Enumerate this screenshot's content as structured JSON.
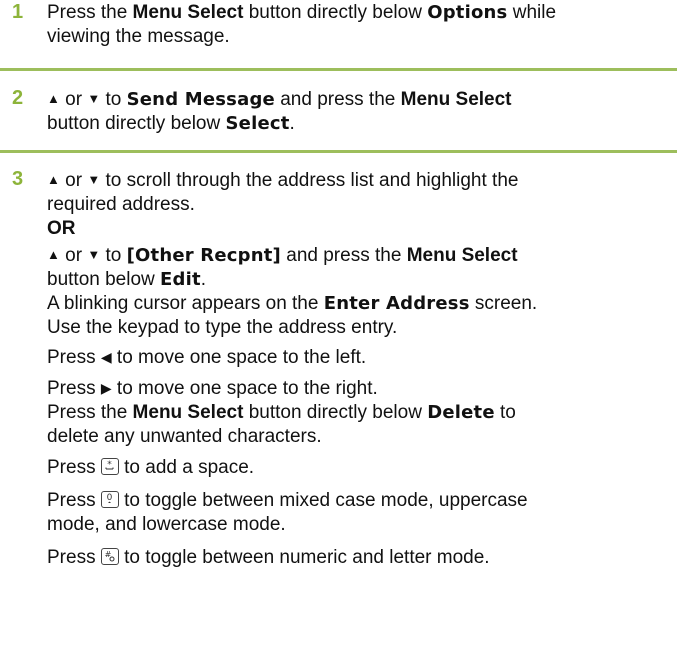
{
  "steps": [
    {
      "number": "1",
      "lines": [
        {
          "pre": "Press the ",
          "bold": "Menu Select",
          "mid": " button directly below ",
          "disp": "Options",
          "post": " while"
        },
        {
          "text": "viewing the message."
        }
      ]
    },
    {
      "number": "2",
      "line1": {
        "up": "▲",
        "or": " or ",
        "down": "▼",
        "to": " to ",
        "disp": "Send Message",
        "mid": " and press the ",
        "bold": "Menu Select"
      },
      "line2": {
        "pre": "button directly below ",
        "disp": "Select",
        "post": "."
      }
    },
    {
      "number": "3",
      "a1": {
        "up": "▲",
        "or": " or ",
        "down": "▼",
        "post": " to scroll through the address list and highlight the"
      },
      "a2": "required address.",
      "or_label": "OR",
      "b1": {
        "up": "▲",
        "or": " or ",
        "down": "▼",
        "to": " to ",
        "disp": "[Other Recpnt]",
        "mid": " and press the ",
        "bold": "Menu Select"
      },
      "b2": {
        "pre": "button below ",
        "disp": "Edit",
        "post": "."
      },
      "c1": {
        "pre": "A blinking cursor appears on the ",
        "disp": "Enter Address",
        "post": " screen."
      },
      "c2": "Use the keypad to type the address entry.",
      "left": {
        "pre": "Press ",
        "icon": "◀",
        "post": " to move one space to the left."
      },
      "right": {
        "pre": "Press ",
        "icon": "▶",
        "post": " to move one space to the right."
      },
      "del1": {
        "pre": "Press the ",
        "bold": "Menu Select",
        "mid": " button directly below ",
        "disp": "Delete",
        "post": " to"
      },
      "del2": "delete any unwanted characters.",
      "space": {
        "pre": "Press ",
        "post": " to add a space."
      },
      "case1": {
        "pre": "Press ",
        "post": " to toggle between mixed case mode, uppercase"
      },
      "case2": "mode, and lowercase mode.",
      "mode": {
        "pre": "Press ",
        "post": " to toggle between numeric and letter mode."
      }
    }
  ],
  "colors": {
    "accent": "#8DB43A",
    "rule": "#9DBE5C"
  }
}
